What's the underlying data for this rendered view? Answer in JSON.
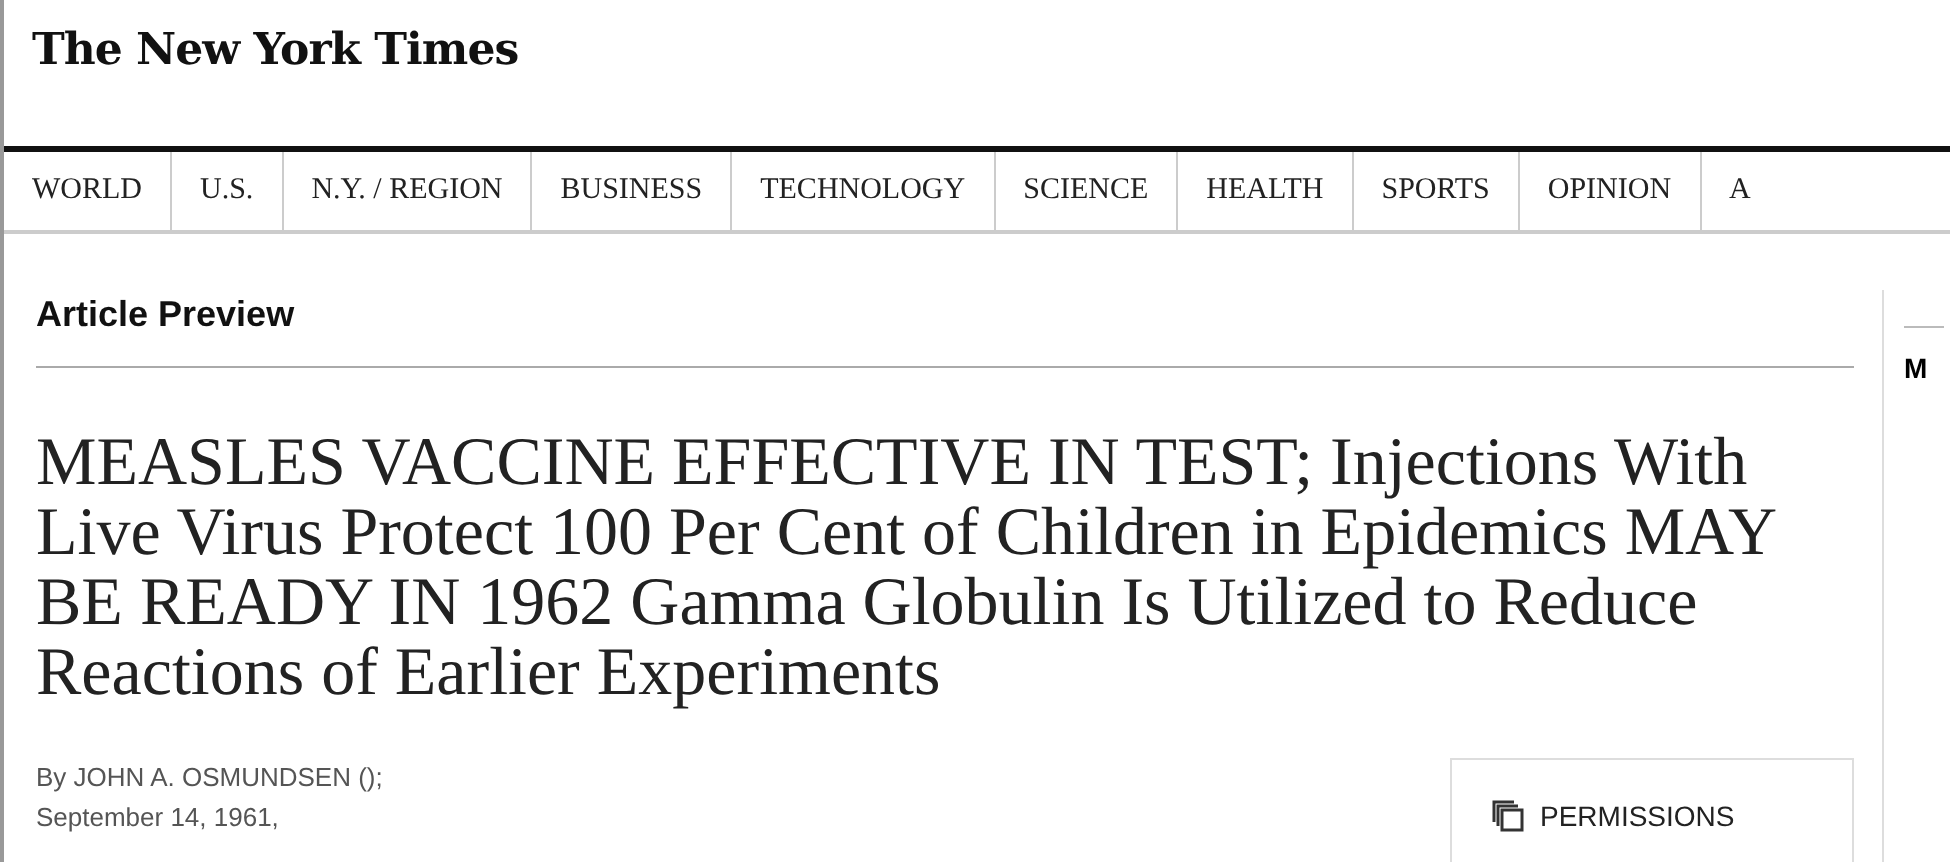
{
  "masthead": {
    "logo": "The New York Times"
  },
  "nav": [
    {
      "label": "WORLD"
    },
    {
      "label": "U.S."
    },
    {
      "label": "N.Y. / REGION"
    },
    {
      "label": "BUSINESS"
    },
    {
      "label": "TECHNOLOGY"
    },
    {
      "label": "SCIENCE"
    },
    {
      "label": "HEALTH"
    },
    {
      "label": "SPORTS"
    },
    {
      "label": "OPINION"
    },
    {
      "label": "A"
    }
  ],
  "section_title": "Article Preview",
  "headline": "MEASLES VACCINE EFFECTIVE IN TEST; Injections With Live Virus Protect 100 Per Cent of Children in Epidemics MAY BE READY IN 1962 Gamma Globulin Is Utilized to Reduce Reactions of Earlier Experiments",
  "byline": "By JOHN A. OSMUNDSEN ();",
  "date": "September 14, 1961,",
  "permissions_button": "PERMISSIONS",
  "sidebar": {
    "heading": "M"
  }
}
